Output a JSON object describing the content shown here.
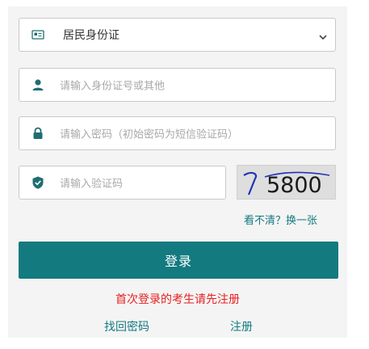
{
  "form": {
    "id_type": {
      "selected": "居民身份证",
      "icon": "id-card-icon"
    },
    "id_number": {
      "placeholder": "请输入身份证号或其他",
      "icon": "user-icon"
    },
    "password": {
      "placeholder": "请输入密码（初始密码为短信验证码）",
      "icon": "lock-icon"
    },
    "captcha": {
      "placeholder": "请输入验证码",
      "icon": "shield-check-icon",
      "image_text": "5800",
      "refresh_label": "看不清？换一张"
    },
    "login_label": "登录",
    "first_login_notice": "首次登录的考生请先注册",
    "retrieve_password_label": "找回密码",
    "register_label": "注册"
  },
  "colors": {
    "accent": "#137a80",
    "notice": "#e62121",
    "icon": "#1e6e72"
  }
}
